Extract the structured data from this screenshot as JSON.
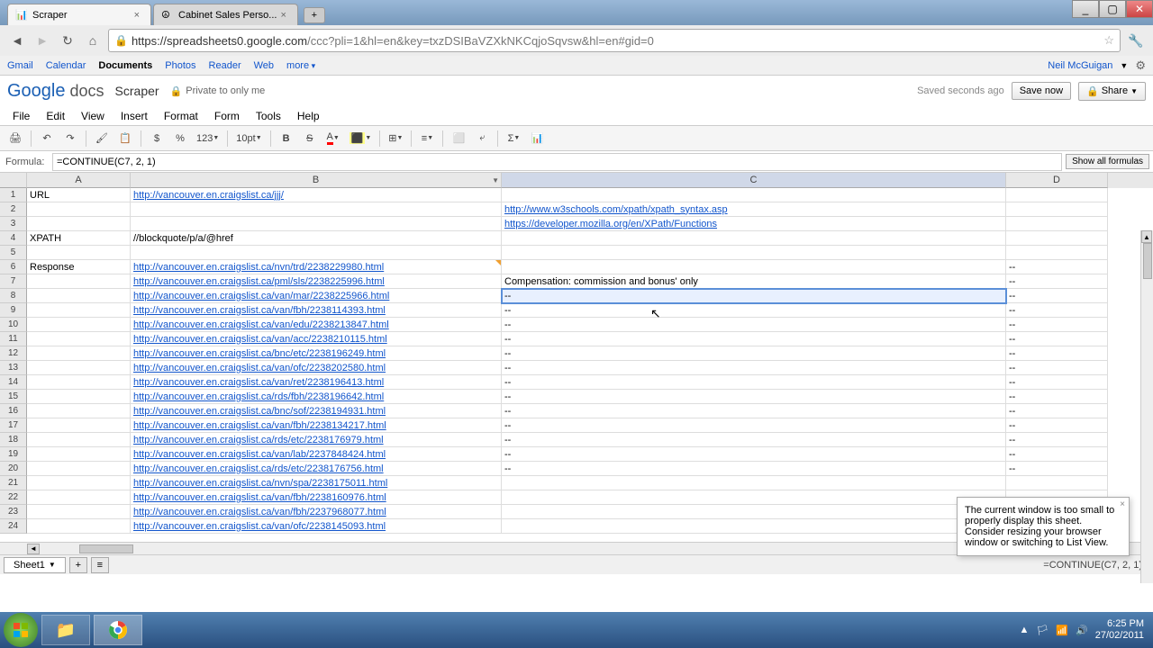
{
  "browser": {
    "tabs": [
      {
        "title": "Scraper",
        "active": true
      },
      {
        "title": "Cabinet Sales Perso...",
        "active": false
      }
    ],
    "url_domain": "https://spreadsheets0.google.com",
    "url_path": "/ccc?pli=1&hl=en&key=txzDSIBaVZXkNKCqjoSqvsw&hl=en#gid=0"
  },
  "google_bar": {
    "links": [
      "Gmail",
      "Calendar",
      "Documents",
      "Photos",
      "Reader",
      "Web"
    ],
    "more": "more",
    "user": "Neil McGuigan",
    "active_index": 2
  },
  "docs": {
    "logo_google": "Google",
    "logo_docs": "docs",
    "title": "Scraper",
    "privacy": "Private to only me",
    "saved": "Saved seconds ago",
    "save_now": "Save now",
    "share": "Share"
  },
  "menus": [
    "File",
    "Edit",
    "View",
    "Insert",
    "Format",
    "Form",
    "Tools",
    "Help"
  ],
  "toolbar": {
    "currency": "$",
    "percent": "%",
    "num_format": "123",
    "font_size": "10pt",
    "bold": "B",
    "strike": "S"
  },
  "formula_bar": {
    "label": "Formula:",
    "value": "=CONTINUE(C7, 2, 1)",
    "show_all": "Show all formulas"
  },
  "columns": [
    "A",
    "B",
    "C",
    "D"
  ],
  "selected_cell": "C8",
  "rows": [
    {
      "n": 1,
      "A": "URL",
      "B": "http://vancouver.en.craigslist.ca/jjj/",
      "C": "",
      "D": ""
    },
    {
      "n": 2,
      "A": "",
      "B": "",
      "C": "http://www.w3schools.com/xpath/xpath_syntax.asp",
      "D": ""
    },
    {
      "n": 3,
      "A": "",
      "B": "",
      "C": "https://developer.mozilla.org/en/XPath/Functions",
      "D": ""
    },
    {
      "n": 4,
      "A": "XPATH",
      "B": "//blockquote/p/a/@href",
      "C": "",
      "D": ""
    },
    {
      "n": 5,
      "A": "",
      "B": "",
      "C": "",
      "D": ""
    },
    {
      "n": 6,
      "A": "Response",
      "B": "http://vancouver.en.craigslist.ca/nvn/trd/2238229980.html",
      "C": "",
      "D": "--",
      "note": true
    },
    {
      "n": 7,
      "A": "",
      "B": "http://vancouver.en.craigslist.ca/pml/sls/2238225996.html",
      "C": "Compensation: commission and bonus' only",
      "D": "--"
    },
    {
      "n": 8,
      "A": "",
      "B": "http://vancouver.en.craigslist.ca/van/mar/2238225966.html",
      "C": "--",
      "D": "--"
    },
    {
      "n": 9,
      "A": "",
      "B": "http://vancouver.en.craigslist.ca/van/fbh/2238114393.html",
      "C": "--",
      "D": "--"
    },
    {
      "n": 10,
      "A": "",
      "B": "http://vancouver.en.craigslist.ca/van/edu/2238213847.html",
      "C": "--",
      "D": "--"
    },
    {
      "n": 11,
      "A": "",
      "B": "http://vancouver.en.craigslist.ca/van/acc/2238210115.html",
      "C": "--",
      "D": "--"
    },
    {
      "n": 12,
      "A": "",
      "B": "http://vancouver.en.craigslist.ca/bnc/etc/2238196249.html",
      "C": "--",
      "D": "--"
    },
    {
      "n": 13,
      "A": "",
      "B": "http://vancouver.en.craigslist.ca/van/ofc/2238202580.html",
      "C": "--",
      "D": "--"
    },
    {
      "n": 14,
      "A": "",
      "B": "http://vancouver.en.craigslist.ca/van/ret/2238196413.html",
      "C": "--",
      "D": "--"
    },
    {
      "n": 15,
      "A": "",
      "B": "http://vancouver.en.craigslist.ca/rds/fbh/2238196642.html",
      "C": "--",
      "D": "--"
    },
    {
      "n": 16,
      "A": "",
      "B": "http://vancouver.en.craigslist.ca/bnc/sof/2238194931.html",
      "C": "--",
      "D": "--"
    },
    {
      "n": 17,
      "A": "",
      "B": "http://vancouver.en.craigslist.ca/van/fbh/2238134217.html",
      "C": "--",
      "D": "--"
    },
    {
      "n": 18,
      "A": "",
      "B": "http://vancouver.en.craigslist.ca/rds/etc/2238176979.html",
      "C": "--",
      "D": "--"
    },
    {
      "n": 19,
      "A": "",
      "B": "http://vancouver.en.craigslist.ca/van/lab/2237848424.html",
      "C": "--",
      "D": "--"
    },
    {
      "n": 20,
      "A": "",
      "B": "http://vancouver.en.craigslist.ca/rds/etc/2238176756.html",
      "C": "--",
      "D": "--"
    },
    {
      "n": 21,
      "A": "",
      "B": "http://vancouver.en.craigslist.ca/nvn/spa/2238175011.html",
      "C": "",
      "D": ""
    },
    {
      "n": 22,
      "A": "",
      "B": "http://vancouver.en.craigslist.ca/van/fbh/2238160976.html",
      "C": "",
      "D": ""
    },
    {
      "n": 23,
      "A": "",
      "B": "http://vancouver.en.craigslist.ca/van/fbh/2237968077.html",
      "C": "",
      "D": ""
    },
    {
      "n": 24,
      "A": "",
      "B": "http://vancouver.en.craigslist.ca/van/ofc/2238145093.html",
      "C": "",
      "D": ""
    }
  ],
  "sheet_tabs": {
    "active": "Sheet1"
  },
  "formula_echo": "=CONTINUE(C7, 2, 1)",
  "notification": "The current window is too small to properly display this sheet. Consider resizing your browser window or switching to List View.",
  "taskbar": {
    "time": "6:25 PM",
    "date": "27/02/2011"
  }
}
